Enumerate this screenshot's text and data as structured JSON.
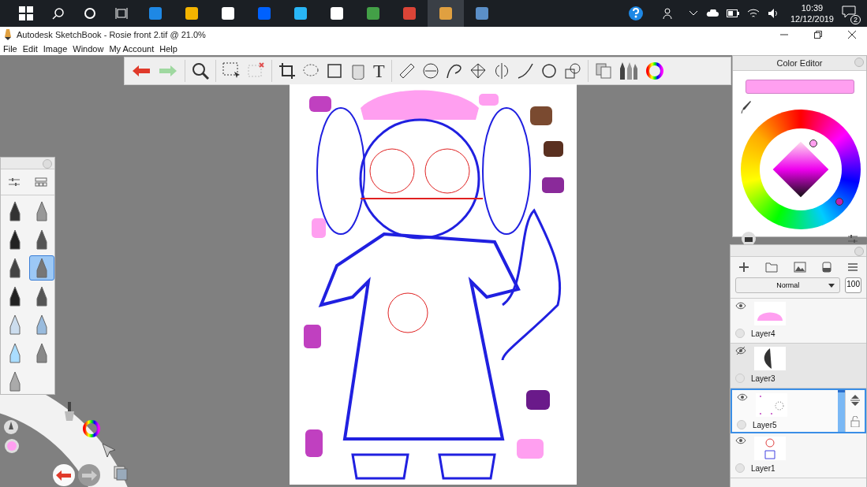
{
  "taskbar": {
    "time": "10:39",
    "date": "12/12/2019",
    "notification_count": "2"
  },
  "window": {
    "title": "Autodesk SketchBook - Rosie front 2.tif @ 21.0%"
  },
  "menu": [
    "File",
    "Edit",
    "Image",
    "Window",
    "My Account",
    "Help"
  ],
  "toolbar": {
    "text_tool": "T"
  },
  "color_editor": {
    "title": "Color Editor"
  },
  "layers": {
    "blend_mode": "Normal",
    "opacity": "100",
    "items": [
      {
        "name": "Layer4",
        "visible": true,
        "selected": false
      },
      {
        "name": "Layer3",
        "visible": false,
        "selected": false
      },
      {
        "name": "Layer5",
        "visible": true,
        "selected": true
      },
      {
        "name": "Layer1",
        "visible": true,
        "selected": false
      }
    ]
  },
  "brushes": [
    {
      "selected": false
    },
    {
      "selected": false
    },
    {
      "selected": false
    },
    {
      "selected": false
    },
    {
      "selected": false
    },
    {
      "selected": true
    },
    {
      "selected": false
    },
    {
      "selected": false
    },
    {
      "selected": false
    },
    {
      "selected": false
    },
    {
      "selected": false
    },
    {
      "selected": false
    },
    {
      "selected": false
    }
  ]
}
